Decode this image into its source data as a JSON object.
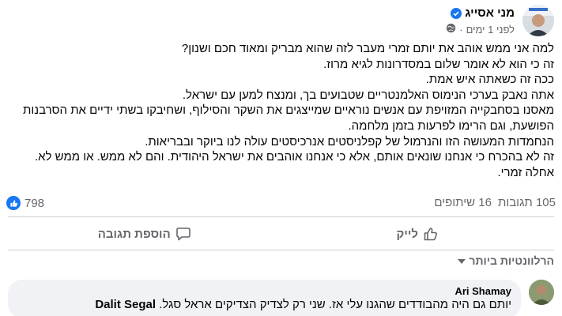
{
  "post": {
    "author_name": "מני אסייג",
    "time": "לפני 1 ימים",
    "separator": "·",
    "lines": [
      "למה אני ממש אוהב את יותם זמרי מעבר לזה שהוא מבריק ומאוד חכם ושנון?",
      "זה כי הוא לא אומר שלום במסדרונות לגיא מרוז.",
      "ככה זה כשאתה איש אמת.",
      "אתה נאבק בערכי הנימוס האלמנטריים שטבועים בך, ומנצח למען עם ישראל.",
      "מאסנו בסחבקיי‏ה המזויפת עם אנשים נוראיים שמייצגים את השקר והסילוף, ושחיבקו בשתי ידיים את הסרבנות",
      "הפושעת, וגם הרימו לפרעות בזמן מלחמה.",
      "הנחמדות המעושה הזו והנרמול של קפלניסטים אנרכיסטים עולה לנו ביוקר ובבריאות.",
      "זה לא בהכרח כי אנחנו שונאים אותם, אלא כי אנחנו אוהבים את ישראל היהודית. והם לא ממש. או ממש לא.",
      "אחלה זמרי."
    ]
  },
  "stats": {
    "likes": "798",
    "comments": "105 תגובות",
    "shares": "16 שיתופים"
  },
  "actions": {
    "like": "לייק",
    "comment": "הוספת תגובה"
  },
  "sort": {
    "label": "הרלוונטיות ביותר"
  },
  "comment": {
    "author": "Ari Shamay",
    "text": "יותם גם היה מהבודדים שהגנו עלי אז. שני רק לצדיק הצדיקים אראל סגל.",
    "mention": "Dalit Segal"
  },
  "colors": {
    "accent": "#1877f2",
    "muted_text": "#65676b",
    "bubble_bg": "#f0f2f5",
    "divider": "#ced0d4"
  }
}
